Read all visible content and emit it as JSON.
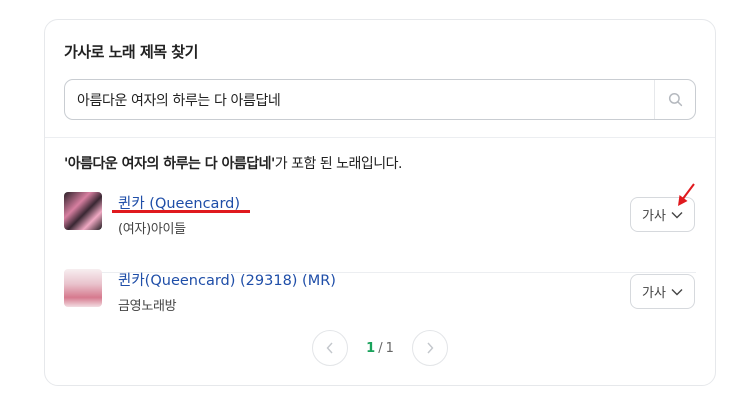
{
  "panel": {
    "title": "가사로 노래 제목 찾기"
  },
  "search": {
    "value": "아름다운 여자의 하루는 다 아름답네",
    "icon": "search-icon"
  },
  "results": {
    "query_quoted": "'아름다운 여자의 하루는 다 아름답네'",
    "caption_suffix": "가 포함 된 노래입니다.",
    "songs": [
      {
        "title": "퀸카 (Queencard)",
        "artist": "(여자)아이들",
        "lyrics_label": "가사"
      },
      {
        "title": "퀸카(Queencard) (29318) (MR)",
        "artist": "금영노래방",
        "lyrics_label": "가사"
      }
    ]
  },
  "pagination": {
    "current": "1",
    "separator": "/",
    "total": "1"
  },
  "colors": {
    "link": "#1f4ea8",
    "annotation": "#e0191e",
    "page_current": "#19a25b"
  }
}
